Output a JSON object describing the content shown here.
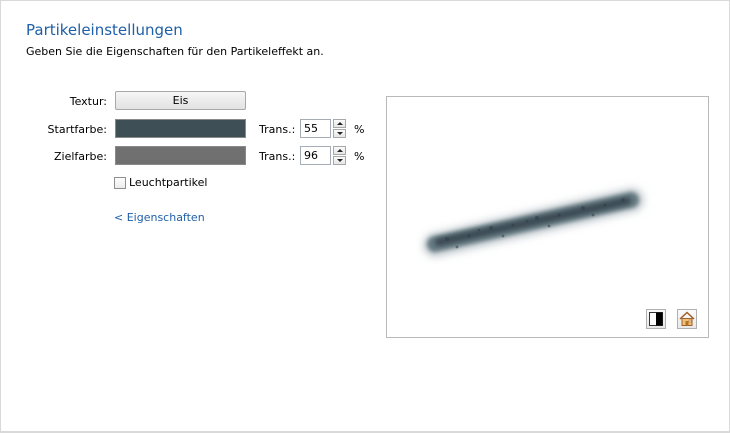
{
  "header": {
    "title": "Partikeleinstellungen",
    "subtitle": "Geben Sie die Eigenschaften für den Partikeleffekt an."
  },
  "form": {
    "texture_label": "Textur:",
    "texture_value": "Eis",
    "start_color_label": "Startfarbe:",
    "start_color": "#3f4f56",
    "end_color_label": "Zielfarbe:",
    "end_color": "#707070",
    "trans_label": "Trans.:",
    "start_trans": "55",
    "end_trans": "96",
    "percent": "%",
    "glow_label": "Leuchtpartikel",
    "glow_checked": false,
    "properties_link": "< Eigenschaften"
  },
  "preview": {
    "toggle_background_icon": "black-white-background-icon",
    "home_icon": "house-icon"
  },
  "colors": {
    "accent": "#1f5fa8",
    "border": "#d9d9d9"
  }
}
